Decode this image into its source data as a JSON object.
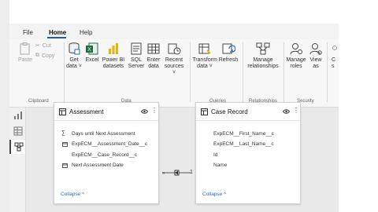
{
  "menu": {
    "file": "File",
    "home": "Home",
    "help": "Help"
  },
  "clipboard": {
    "paste": "Paste",
    "cut": "Cut",
    "copy": "Copy",
    "group": "Clipboard"
  },
  "data_group": {
    "get_data": "Get data ˅",
    "excel": "Excel",
    "powerbi": "Power BI datasets",
    "sql": "SQL Server",
    "enter": "Enter data",
    "recent": "Recent sources ˅",
    "group": "Data"
  },
  "queries": {
    "transform": "Transform data ˅",
    "refresh": "Refresh",
    "group": "Queries"
  },
  "relationships": {
    "manage": "Manage relationships",
    "group": "Relationships"
  },
  "security": {
    "manage_roles": "Manage roles",
    "view_as": "View as",
    "group": "Security"
  },
  "cut_off": {
    "partial_label": "C",
    "partial_label2": "s"
  },
  "assessment": {
    "title": "Assessment",
    "fields": [
      "Days until Next Assessment",
      "ExpECM__Assessment_Date__c",
      "ExpECM__Case_Record__c",
      "Next Assessment Date"
    ],
    "collapse": "Collapse"
  },
  "case_record": {
    "title": "Case Record",
    "fields": [
      "ExpECM__First_Name__c",
      "ExpECM__Last_Name__c",
      "Id",
      "Name"
    ],
    "collapse": "Collapse"
  },
  "relationship": {
    "one_marker": "1",
    "many_marker": "*"
  },
  "colors": {
    "accent": "#1e5fa8",
    "link": "#2a6ebb"
  }
}
